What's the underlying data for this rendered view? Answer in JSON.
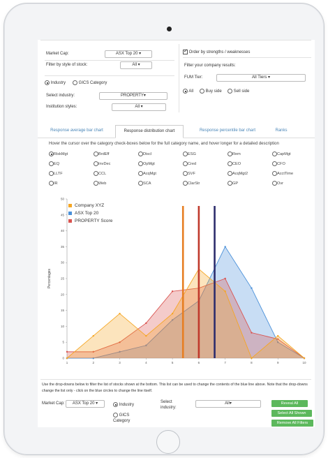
{
  "filters": {
    "market_cap_label": "Market Cap:",
    "market_cap_value": "ASX Top 20 ▾",
    "style_label": "Filter by style of stock:",
    "style_value": "All ▾",
    "industry_radio": "Industry",
    "gics_radio": "GICS Category",
    "select_industry_label": "Select industry:",
    "select_industry_value": "PROPERTY▾",
    "institution_label": "Institution styles:",
    "institution_value": "All ▾",
    "order_checkbox": "Order by strengths / weaknesses",
    "filter_company_label": "Filter your company results:",
    "fum_label": "FUM Tier:",
    "fum_value": "All Tiers ▾",
    "side_all": "All",
    "side_buy": "Buy side",
    "side_sell": "Sell side"
  },
  "tabs": [
    {
      "label": "Response average bar chart",
      "active": false
    },
    {
      "label": "Response distribution chart",
      "active": true
    },
    {
      "label": "Response percentile bar chart",
      "active": false
    },
    {
      "label": "Ranks",
      "active": false
    }
  ],
  "hint": "Hover the cursor over the category check-boxes below for the full category name, and hover longer for a detailed description",
  "categories": [
    {
      "label": "RiskMgt",
      "selected": true
    },
    {
      "label": "BrdEff",
      "selected": false
    },
    {
      "label": "Discl",
      "selected": false
    },
    {
      "label": "ESG",
      "selected": false
    },
    {
      "label": "Rem",
      "selected": false
    },
    {
      "label": "CapMgt",
      "selected": false
    },
    {
      "label": "EQ",
      "selected": false
    },
    {
      "label": "InvDec",
      "selected": false
    },
    {
      "label": "OpMgt",
      "selected": false
    },
    {
      "label": "Cred",
      "selected": false
    },
    {
      "label": "CEO",
      "selected": false
    },
    {
      "label": "CFO",
      "selected": false
    },
    {
      "label": "LLTF",
      "selected": false
    },
    {
      "label": "CCL",
      "selected": false
    },
    {
      "label": "AcqMgt",
      "selected": false
    },
    {
      "label": "SVF",
      "selected": false
    },
    {
      "label": "AcqMgt2",
      "selected": false
    },
    {
      "label": "AcctTime",
      "selected": false
    },
    {
      "label": "IR",
      "selected": false
    },
    {
      "label": "Web",
      "selected": false
    },
    {
      "label": "SCA",
      "selected": false
    },
    {
      "label": "ClarStr",
      "selected": false
    },
    {
      "label": "GP",
      "selected": false
    },
    {
      "label": "Ovr",
      "selected": false
    }
  ],
  "chart_data": {
    "type": "area",
    "ylabel": "Percentages",
    "x": [
      1,
      2,
      3,
      4,
      5,
      6,
      7,
      8,
      9,
      10
    ],
    "ylim": [
      0,
      50
    ],
    "xlim": [
      1,
      10
    ],
    "y_ticks": [
      0,
      5,
      10,
      15,
      20,
      25,
      30,
      35,
      40,
      45,
      50
    ],
    "series": [
      {
        "name": "Company XYZ",
        "color": "#f5a623",
        "values": [
          0,
          7,
          14,
          7,
          14,
          28,
          21,
          0,
          7,
          0
        ]
      },
      {
        "name": "ASX Top 20",
        "color": "#4a90d9",
        "values": [
          0,
          0,
          2,
          4,
          12,
          18,
          35,
          22,
          5,
          0
        ]
      },
      {
        "name": "PROPERTY Score",
        "color": "#d9534f",
        "values": [
          2,
          2,
          5,
          11,
          21,
          22,
          25,
          8,
          6,
          0
        ]
      }
    ],
    "vlines": [
      {
        "x": 5.4,
        "color": "#e67e22"
      },
      {
        "x": 6.0,
        "color": "#c0392b"
      },
      {
        "x": 6.6,
        "color": "#2c2c6c"
      }
    ],
    "legend_position": "top-left",
    "grid": false
  },
  "bottom": {
    "note": "Use the drop-downs below to filter the list of stocks shown at the bottom. This list can be used to change the contents of the blue line above. Note that the drop-downs change the list only - click on the blue circles to change the line itself.",
    "market_cap_label": "Market Cap:",
    "market_cap_value": "ASX Top 20 ▾",
    "industry_radio": "Industry",
    "gics_radio": "GICS Category",
    "select_industry_label": "Select industry:",
    "select_industry_value": "All▾",
    "reveal_all": "Reveal All",
    "select_all_shown": "Select All Shown",
    "remove_all_filters": "Remove All Filters"
  }
}
